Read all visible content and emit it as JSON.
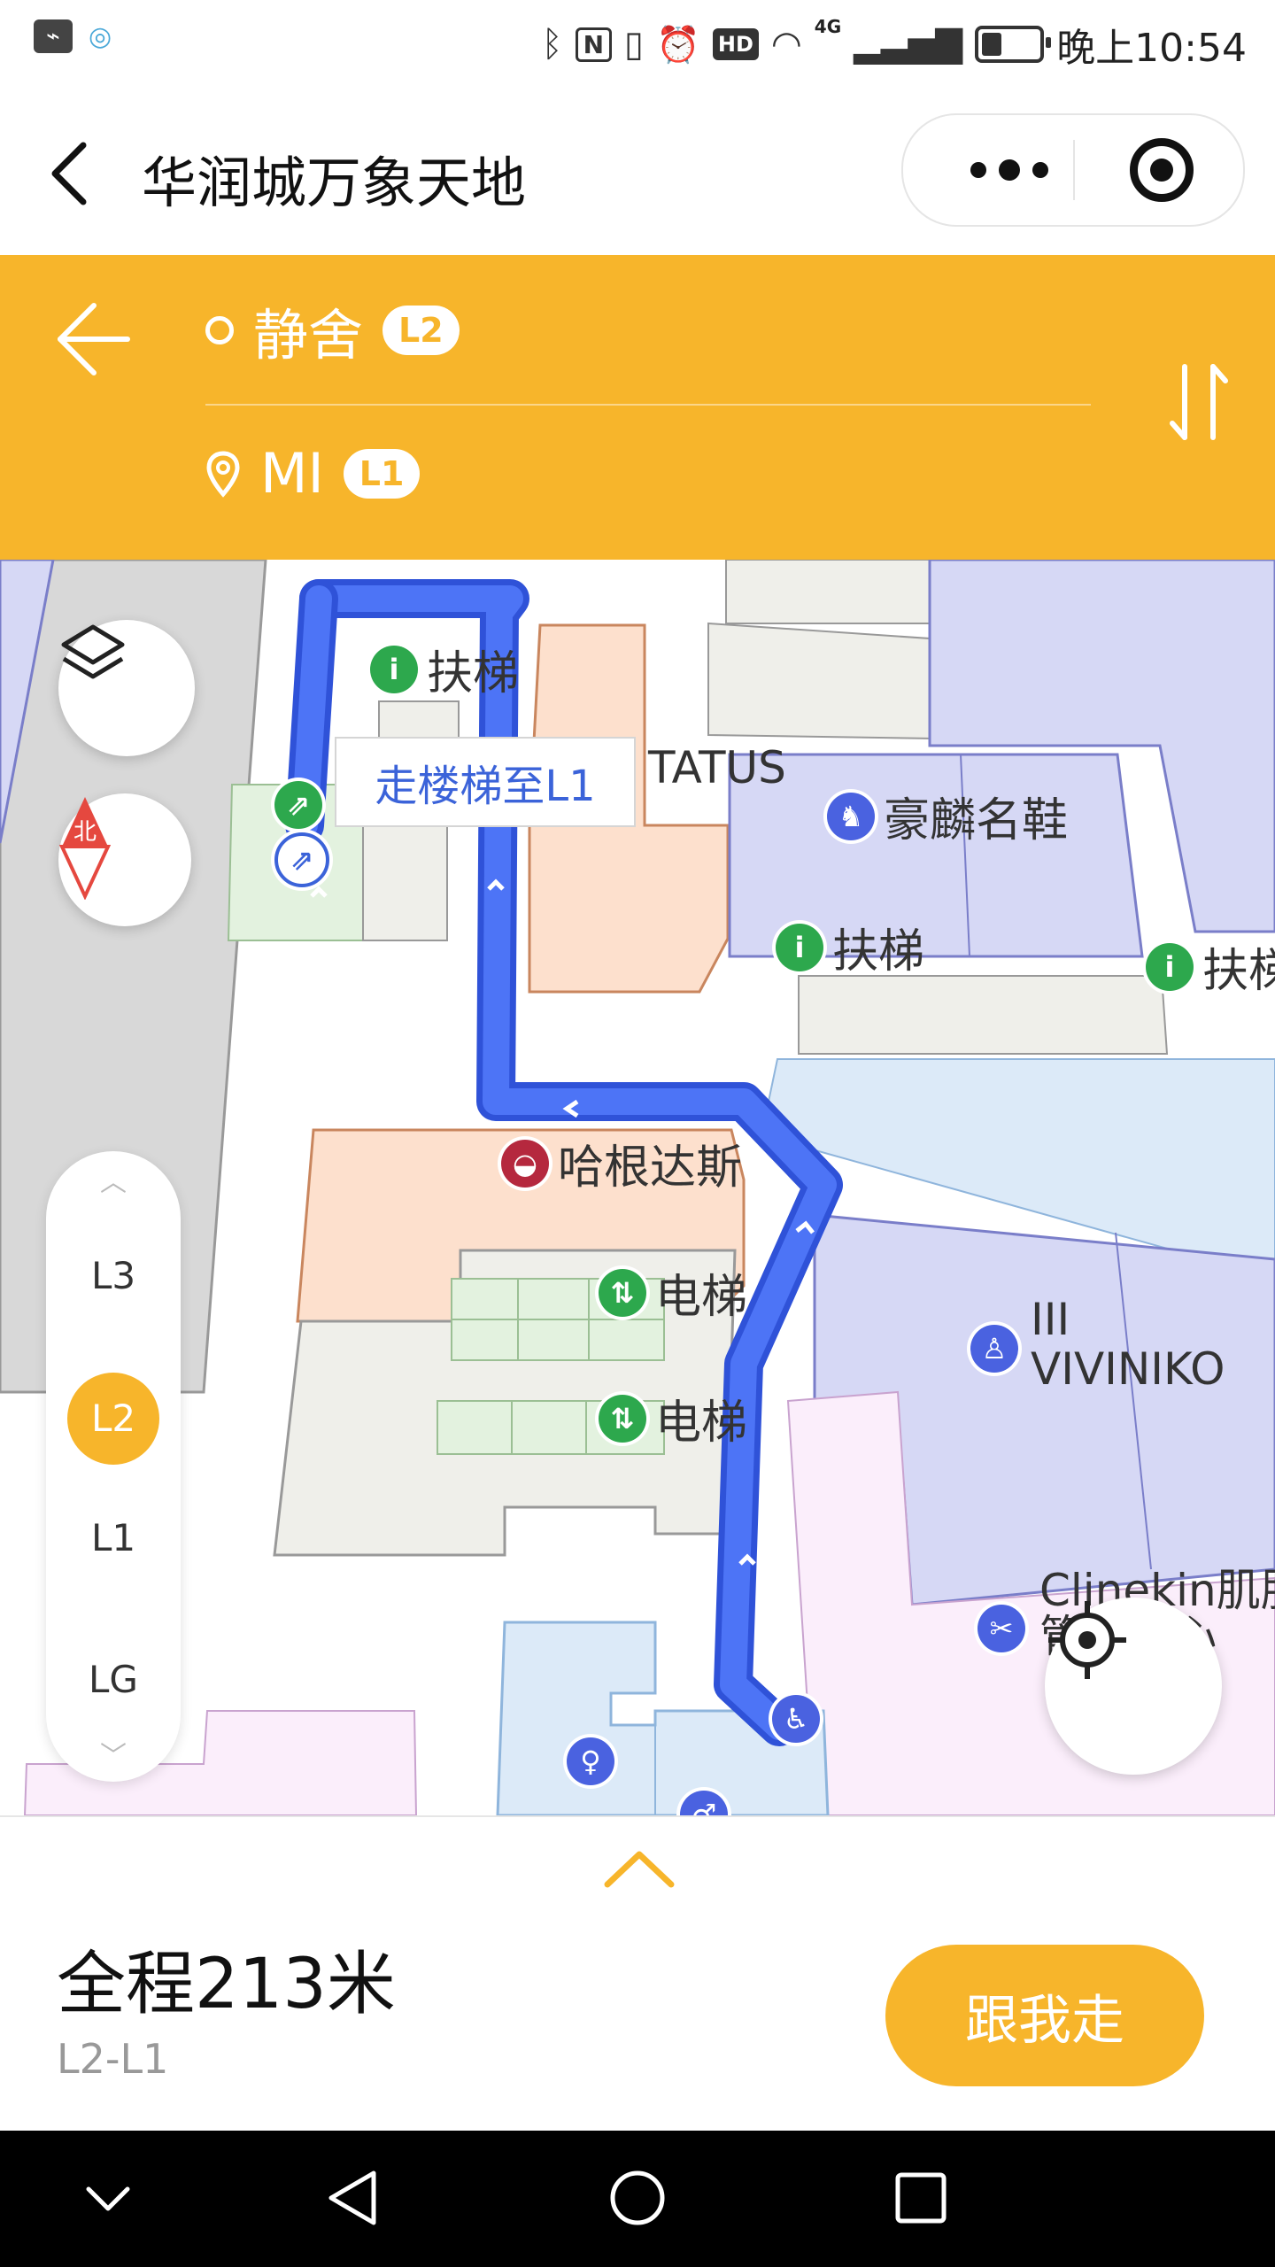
{
  "status_bar": {
    "time": "晚上10:54",
    "network_label": "4G",
    "hd_label": "HD"
  },
  "header": {
    "title": "华润城万象天地"
  },
  "route": {
    "origin": {
      "name": "静舍",
      "floor": "L2"
    },
    "destination": {
      "name": "MI",
      "floor": "L1"
    }
  },
  "map": {
    "tooltip": "走楼梯至L1",
    "labels": {
      "escalator": "扶梯",
      "elevator": "电梯",
      "tatus": "TATUS",
      "shoe_store": "豪麟名鞋",
      "haagen": "哈根达斯",
      "viviniko_1": "III",
      "viviniko_2": "VIVINIKO",
      "clinekin_1": "Clinekin肌肤",
      "clinekin_2": "管理中心",
      "escalator_cut": "扶梯"
    },
    "compass_label": "北"
  },
  "floors": [
    "L3",
    "L2",
    "L1",
    "LG"
  ],
  "active_floor": "L2",
  "summary": {
    "total": "全程213米",
    "floors": "L2-L1",
    "follow_label": "跟我走"
  },
  "colors": {
    "accent": "#f7b52b",
    "route": "#3d63ee"
  }
}
